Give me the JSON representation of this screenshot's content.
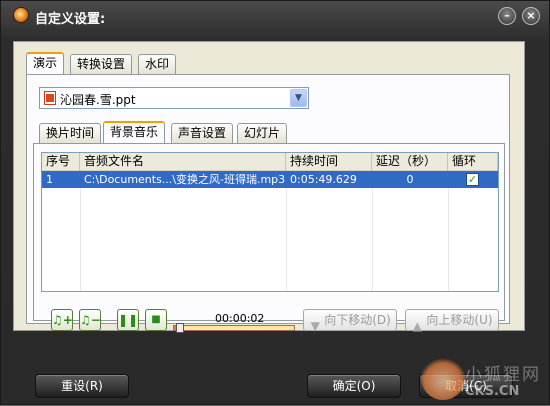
{
  "window": {
    "title": "自定义设置:"
  },
  "outer_tabs": [
    {
      "label": "演示",
      "active": true
    },
    {
      "label": "转换设置",
      "active": false
    },
    {
      "label": "水印",
      "active": false
    }
  ],
  "file_select": {
    "value": "沁园春.雪.ppt"
  },
  "inner_tabs": [
    {
      "label": "换片时间",
      "active": false
    },
    {
      "label": "背景音乐",
      "active": true
    },
    {
      "label": "声音设置",
      "active": false
    },
    {
      "label": "幻灯片",
      "active": false
    }
  ],
  "table": {
    "headers": [
      "序号",
      "音频文件名",
      "持续时间",
      "延迟（秒）",
      "循环"
    ],
    "rows": [
      {
        "index": "1",
        "file": "C:\\Documents...\\变换之风-班得瑞.mp3",
        "duration": "0:05:49.629",
        "delay": "0",
        "loop": true
      }
    ]
  },
  "player": {
    "time": "00:00:02",
    "progress_fraction": 0.02
  },
  "buttons": {
    "move_down": "向下移动(D)",
    "move_up": "向上移动(U)",
    "reset": "重设(R)",
    "ok": "确定(O)",
    "cancel": "取消(C)"
  },
  "watermark": {
    "line1": "小狐狸网",
    "line2": "CKS.CN"
  },
  "colors": {
    "selection": "#316ac5",
    "active_tab_accent": "#f0a000"
  }
}
